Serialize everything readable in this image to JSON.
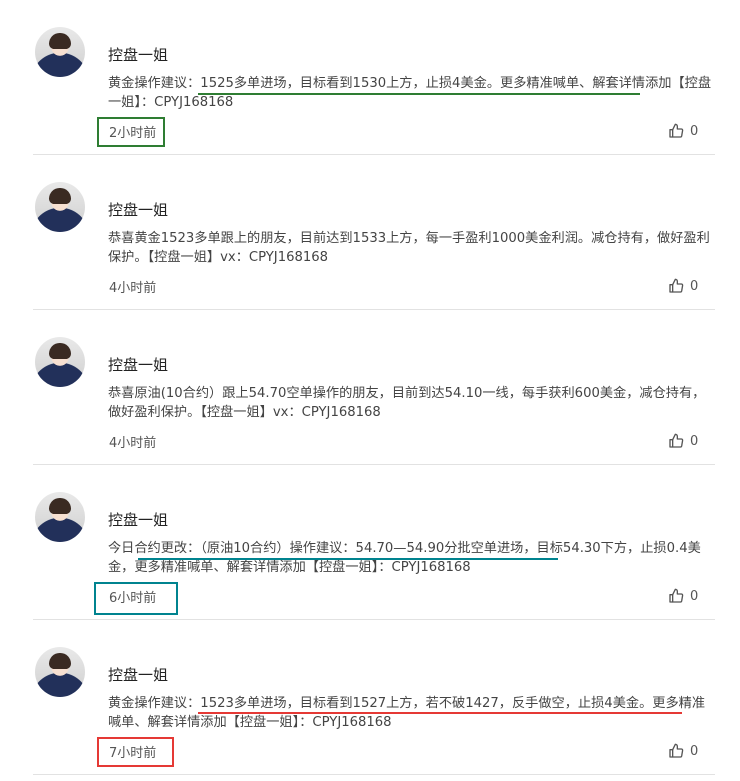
{
  "posts": [
    {
      "author": "控盘一姐",
      "text": "黄金操作建议：1525多单进场，目标看到1530上方，止损4美金。更多精准喊单、解套详情添加【控盘一姐】：CPYJ168168",
      "time": "2小时前",
      "likes": "0"
    },
    {
      "author": "控盘一姐",
      "text": "恭喜黄金1523多单跟上的朋友，目前达到1533上方，每一手盈利1000美金利润。减仓持有，做好盈利保护。【控盘一姐】vx：CPYJ168168",
      "time": "4小时前",
      "likes": "0"
    },
    {
      "author": "控盘一姐",
      "text": "恭喜原油(10合约）跟上54.70空单操作的朋友，目前到达54.10一线，每手获利600美金，减仓持有，做好盈利保护。【控盘一姐】vx：CPYJ168168",
      "time": "4小时前",
      "likes": "0"
    },
    {
      "author": "控盘一姐",
      "text": "今日合约更改：（原油10合约）操作建议：54.70—54.90分批空单进场，目标54.30下方，止损0.4美金，更多精准喊单、解套详情添加【控盘一姐】：CPYJ168168",
      "time": "6小时前",
      "likes": "0"
    },
    {
      "author": "控盘一姐",
      "text": "黄金操作建议：1523多单进场，目标看到1527上方，若不破1427，反手做空，止损4美金。更多精准喊单、解套详情添加【控盘一姐】：CPYJ168168",
      "time": "7小时前",
      "likes": "0"
    }
  ],
  "colors": {
    "green_mark": "#2e7d32",
    "teal_mark": "#00838f",
    "red_mark": "#e53935",
    "divider": "#e2e2e2"
  },
  "icons": {
    "like": "thumbs-up-icon",
    "avatar": "avatar"
  }
}
